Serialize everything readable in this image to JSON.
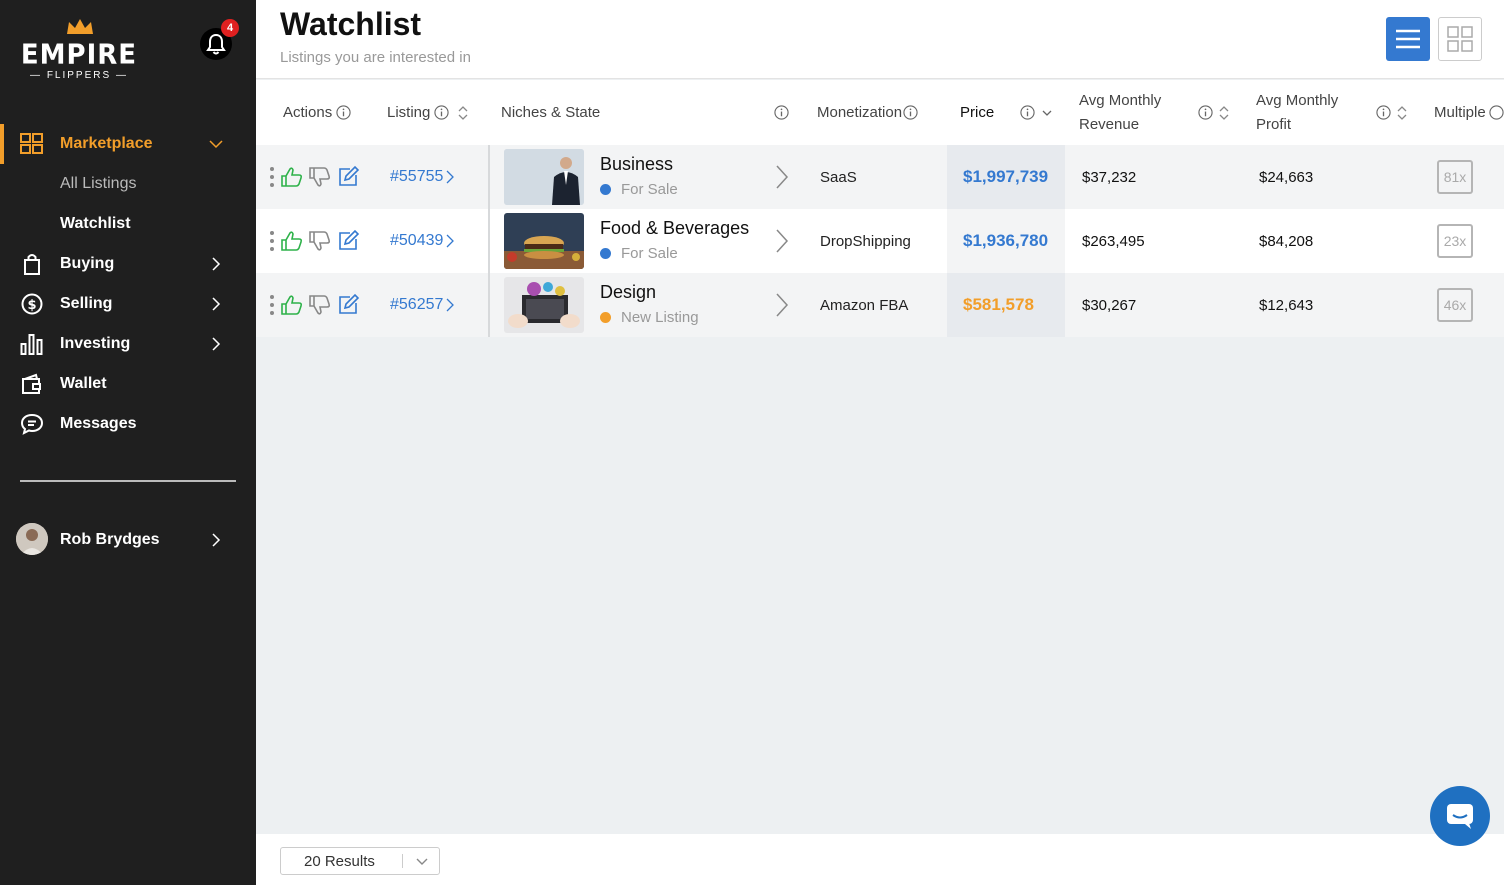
{
  "brand": {
    "name": "EMPIRE",
    "tagline": "FLIPPERS"
  },
  "notifications": {
    "count": "4"
  },
  "sidebar": {
    "items": [
      {
        "label": "Marketplace",
        "icon": "grid-icon",
        "active": true
      },
      {
        "label": "Buying",
        "icon": "shopping-bag-icon"
      },
      {
        "label": "Selling",
        "icon": "dollar-circle-icon"
      },
      {
        "label": "Investing",
        "icon": "bar-chart-icon"
      },
      {
        "label": "Wallet",
        "icon": "wallet-icon"
      },
      {
        "label": "Messages",
        "icon": "chat-bubble-icon"
      }
    ],
    "subitems": [
      {
        "label": "All Listings"
      },
      {
        "label": "Watchlist",
        "current": true
      }
    ],
    "user": {
      "name": "Rob Brydges"
    }
  },
  "header": {
    "title": "Watchlist",
    "subtitle": "Listings you are interested in"
  },
  "table": {
    "columns": {
      "actions": "Actions",
      "listing": "Listing",
      "niches": "Niches & State",
      "monetization": "Monetization",
      "price": "Price",
      "revenue_l1": "Avg Monthly",
      "revenue_l2": "Revenue",
      "profit_l1": "Avg Monthly",
      "profit_l2": "Profit",
      "multiple": "Multiple"
    },
    "rows": [
      {
        "listing": "#55755",
        "niche": "Business",
        "state": "For Sale",
        "state_color": "#3479d0",
        "monetization": "SaaS",
        "price": "$1,997,739",
        "price_color": "#3479d0",
        "revenue": "$37,232",
        "profit": "$24,663",
        "multiple": "81x"
      },
      {
        "listing": "#50439",
        "niche": "Food & Beverages",
        "state": "For Sale",
        "state_color": "#3479d0",
        "monetization": "DropShipping",
        "price": "$1,936,780",
        "price_color": "#3479d0",
        "revenue": "$263,495",
        "profit": "$84,208",
        "multiple": "23x"
      },
      {
        "listing": "#56257",
        "niche": "Design",
        "state": "New Listing",
        "state_color": "#f29e2a",
        "monetization": "Amazon FBA",
        "price": "$581,578",
        "price_color": "#f29e2a",
        "revenue": "$30,267",
        "profit": "$12,643",
        "multiple": "46x"
      }
    ]
  },
  "footer": {
    "results": "20 Results"
  },
  "colors": {
    "accent": "#f29e2a",
    "primary": "#3479d0",
    "sidebar": "#1f1f1f",
    "thumbs_up": "#2eb24a"
  }
}
